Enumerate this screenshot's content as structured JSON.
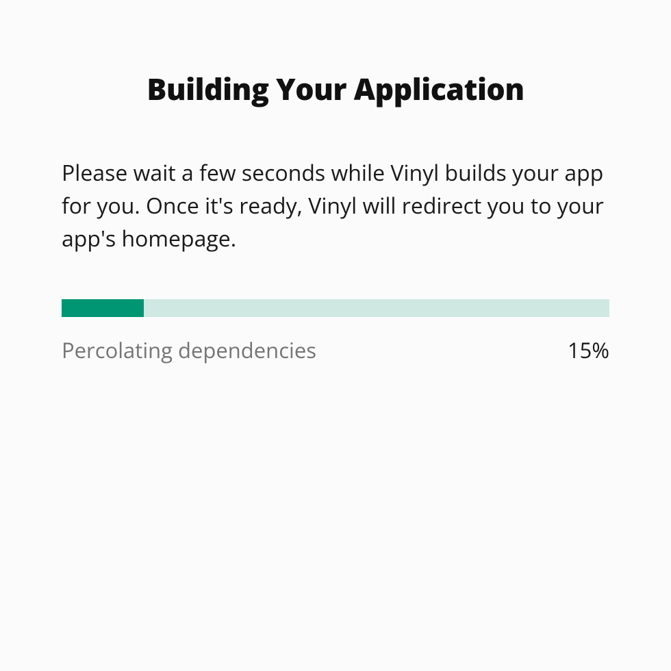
{
  "header": {
    "title": "Building Your Application"
  },
  "body": {
    "description": "Please wait a few seconds while Vinyl builds your app for you. Once it's ready, Vinyl will redirect you to your app's homepage."
  },
  "progress": {
    "percent": 15,
    "percent_label": "15%",
    "status": "Percolating dependencies",
    "track_color": "#cfe8e2",
    "fill_color": "#009673"
  }
}
